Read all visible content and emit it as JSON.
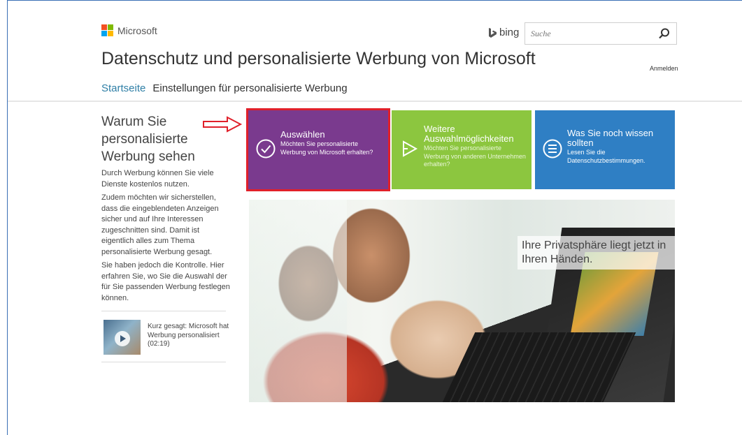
{
  "header": {
    "brand": "Microsoft",
    "brand_colors": [
      "#f25022",
      "#7fba00",
      "#00a4ef",
      "#ffb900"
    ],
    "bing_label": "bing",
    "search_placeholder": "Suche",
    "title": "Datenschutz und personalisierte Werbung von Microsoft",
    "signin": "Anmelden"
  },
  "nav": {
    "items": [
      {
        "label": "Startseite",
        "active": true
      },
      {
        "label": "Einstellungen für personalisierte Werbung",
        "active": false
      }
    ]
  },
  "sidebar": {
    "heading": "Warum Sie personalisierte Werbung sehen",
    "paragraphs": [
      "Durch Werbung können Sie viele Dienste kostenlos nutzen.",
      "Zudem möchten wir sicherstellen, dass die eingeblendeten Anzeigen sicher und auf Ihre Interessen zugeschnitten sind. Damit ist eigentlich alles zum Thema personalisierte Werbung gesagt.",
      "Sie haben jedoch die Kontrolle. Hier erfahren Sie, wo Sie die Auswahl der für Sie passenden Werbung festlegen können."
    ],
    "video_label": "Kurz gesagt: Microsoft hat Werbung personalisiert (02:19)"
  },
  "tiles": [
    {
      "title": "Auswählen",
      "subtitle": "Möchten Sie personalisierte Werbung von Microsoft erhalten?",
      "color": "#7a3a8e",
      "icon": "check-circle-icon"
    },
    {
      "title": "Weitere Auswahlmöglichkeiten",
      "subtitle": "Möchten Sie personalisierte Werbung von anderen Unternehmen erhalten?",
      "color": "#8cc63f",
      "icon": "play-arrow-icon"
    },
    {
      "title": "Was Sie noch wissen sollten",
      "subtitle": "Lesen Sie die Datenschutzbestimmungen.",
      "color": "#2f7fc4",
      "icon": "list-circle-icon"
    }
  ],
  "hero": {
    "caption": "Ihre Privatsphäre liegt jetzt in Ihren Händen."
  },
  "annotation": {
    "arrow_color": "#e0202a",
    "highlight_color": "#e0202a"
  }
}
